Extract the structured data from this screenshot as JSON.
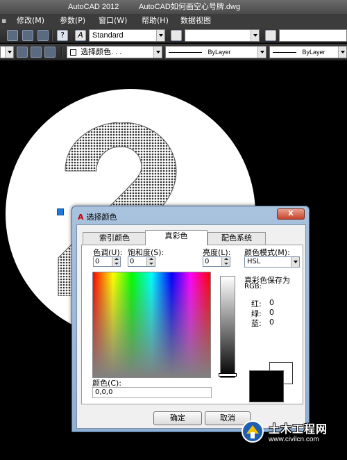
{
  "window": {
    "app_title": "AutoCAD 2012",
    "doc_title": "AutoCAD如何画空心号牌.dwg"
  },
  "menu": [
    {
      "label": "修改(M)"
    },
    {
      "label": "参数(P)"
    },
    {
      "label": "窗口(W)"
    },
    {
      "label": "帮助(H)"
    },
    {
      "label": "数据视图"
    }
  ],
  "toolbar1": {
    "text_style": "Standard"
  },
  "toolbar2": {
    "color_combo": "选择颜色. . .",
    "linetype_combo": "ByLayer",
    "lineweight_combo": "ByLayer"
  },
  "drawing": {
    "glyph": "2"
  },
  "dialog": {
    "title": "选择颜色",
    "close_label": "X",
    "tabs": [
      {
        "label": "索引颜色",
        "active": false
      },
      {
        "label": "真彩色",
        "active": true
      },
      {
        "label": "配色系统",
        "active": false
      }
    ],
    "hue_label": "色调(U):",
    "hue_value": "0",
    "sat_label": "饱和度(S):",
    "sat_value": "0",
    "lum_label": "亮度(L):",
    "lum_value": "0",
    "color_model_label": "颜色模式(M):",
    "color_model_value": "HSL",
    "truecolor_save_label": "真彩色保存为",
    "rgb_label": "RGB:",
    "red_label": "红:",
    "red_value": "0",
    "green_label": "绿:",
    "green_value": "0",
    "blue_label": "蓝:",
    "blue_value": "0",
    "color_field_label": "颜色(C):",
    "color_field_value": "0,0,0",
    "ok_label": "确定",
    "cancel_label": "取消"
  },
  "watermark": {
    "title": "土木工程网",
    "url": "www.civilcn.com"
  },
  "colors": {
    "dialog_frame": "#a9c2de",
    "close_button": "#c8442b",
    "grip": "#1e7ae0",
    "current_color": "#000000"
  }
}
